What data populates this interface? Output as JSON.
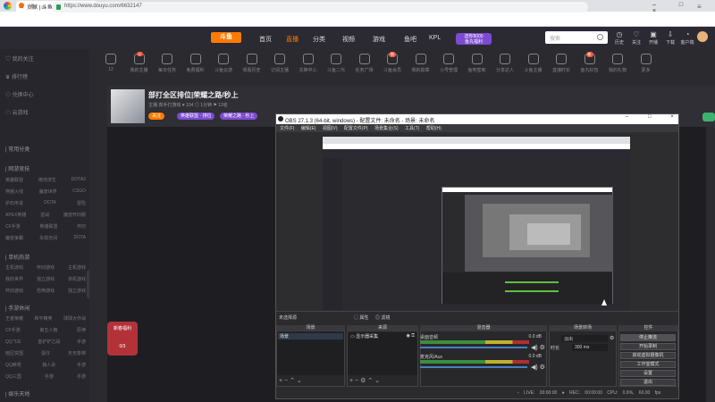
{
  "browser": {
    "tab_title": "贡献 | 斗鱼直播_斗鱼…",
    "url": "https://www.douyu.com/6632147",
    "newtab": "+",
    "win_ctrls": "– □ ×"
  },
  "header": {
    "nav": [
      "首页",
      "直播",
      "分类",
      "视频",
      "游戏",
      "鱼吧",
      "KPL"
    ],
    "logo": "斗鱼",
    "badge_line1": "送你8000",
    "badge_line2": "鱼丸福利",
    "search_placeholder": "搜索",
    "icons": [
      {
        "label": "历史",
        "icon": "history-icon"
      },
      {
        "label": "关注",
        "icon": "heart-icon"
      },
      {
        "label": "开播",
        "icon": "camera-icon"
      },
      {
        "label": "下载",
        "icon": "download-icon"
      },
      {
        "label": "客户端",
        "icon": "app-icon"
      },
      {
        "label": "消息",
        "icon": "bell-icon"
      }
    ]
  },
  "sidebar": {
    "items": [
      "我的关注",
      "排行榜",
      "兑换中心",
      "云游戏"
    ],
    "sections": [
      {
        "title": "| 常用分类",
        "rows": []
      },
      {
        "title": "| 网游竞技",
        "rows": [
          [
            "英雄联盟",
            "绝地求生",
            "DOTA2"
          ],
          [
            "穿越火线",
            "魔兽世界",
            "CSGO"
          ],
          [
            "炉石传说",
            "DOTA",
            "冒险"
          ],
          [
            "APEX英雄",
            "逆战",
            "魔兽怀旧服"
          ],
          [
            "CF手游",
            "英雄联盟",
            "怀旧"
          ],
          [
            "魔兽争霸",
            "永劫无间",
            "DOTA"
          ]
        ]
      },
      {
        "title": "| 单机热游",
        "rows": [
          [
            "主机游戏",
            "怀旧游戏",
            "主机游戏"
          ],
          [
            "我的世界",
            "独立游戏",
            "单机游戏"
          ],
          [
            "怀旧游戏",
            "恐怖游戏",
            "独立游戏"
          ]
        ]
      },
      {
        "title": "| 手游休闲",
        "rows": [
          [
            "王者荣耀",
            "和平精英",
            "球球大作战"
          ],
          [
            "CF手游",
            "第五人格",
            "原神"
          ],
          [
            "QQ飞车",
            "金铲铲之战",
            "手游"
          ],
          [
            "暗区突围",
            "蛋仔",
            "天天象棋"
          ],
          [
            "QQ麻将",
            "狼人杀",
            "手游"
          ],
          [
            "QQ三国",
            "手游",
            "手游"
          ]
        ]
      },
      {
        "title": "| 娱乐天地",
        "rows": []
      }
    ]
  },
  "categories": [
    {
      "label": "12",
      "sub": "元宵订阅",
      "badge": ""
    },
    {
      "label": "我的主播",
      "sub": "",
      "badge": "2"
    },
    {
      "label": "每日任务",
      "sub": "",
      "badge": ""
    },
    {
      "label": "免费福利",
      "sub": "",
      "badge": ""
    },
    {
      "label": "斗鱼云游",
      "sub": "",
      "badge": ""
    },
    {
      "label": "观看历史",
      "sub": "",
      "badge": ""
    },
    {
      "label": "订阅主播",
      "sub": "",
      "badge": ""
    },
    {
      "label": "兑换中心",
      "sub": "",
      "badge": ""
    },
    {
      "label": "斗鱼二代",
      "sub": "",
      "badge": ""
    },
    {
      "label": "任务广场",
      "sub": "",
      "badge": ""
    },
    {
      "label": "斗鱼会员",
      "sub": "",
      "badge": "新"
    },
    {
      "label": "我的勋章",
      "sub": "",
      "badge": ""
    },
    {
      "label": "小号管理",
      "sub": "",
      "badge": ""
    },
    {
      "label": "鱼吧签到",
      "sub": "",
      "badge": ""
    },
    {
      "label": "分享达人",
      "sub": "",
      "badge": ""
    },
    {
      "label": "斗鱼主播",
      "sub": "",
      "badge": ""
    },
    {
      "label": "直播时长",
      "sub": "",
      "badge": ""
    },
    {
      "label": "鱼丸红包",
      "sub": "",
      "badge": "新"
    },
    {
      "label": "我的礼物",
      "sub": "",
      "badge": ""
    },
    {
      "label": "更多",
      "sub": "",
      "badge": ""
    }
  ],
  "stream": {
    "title": "部打全区排位|荣耀之路/秒上",
    "meta": "主播 高手打游戏  ♥ 104  ◎ 1分钟  ⚑ 13名",
    "tag1": "关注",
    "tag2": "英雄联盟 · 排位",
    "tag3": "荣耀之路 · 秒上",
    "gift_label": "新春福利",
    "gift_count": "0/3"
  },
  "obs": {
    "title": "OBS 27.1.3 (64-bit, windows) - 配置文件: 未命名 - 场景: 未命名",
    "menu": [
      "文件(F)",
      "编辑(E)",
      "视图(V)",
      "配置文件(P)",
      "场景集合(S)",
      "工具(T)",
      "帮助(H)"
    ],
    "srcbar_label": "未选择源",
    "props_btn": "◯ 属性",
    "filter_btn": "◎ 滤镜",
    "docks": {
      "scenes": {
        "title": "场景",
        "items": [
          "场景"
        ]
      },
      "sources": {
        "title": "来源",
        "items": [
          "显示器采集"
        ]
      },
      "mixer": {
        "title": "混音器",
        "rows": [
          {
            "name": "桌面音频",
            "db": "0.0 dB"
          },
          {
            "name": "麦克风/Aux",
            "db": "0.0 dB"
          }
        ]
      },
      "transitions": {
        "title": "场景转场",
        "type": "淡出",
        "duration_label": "时长",
        "duration": "300 ms"
      },
      "controls": {
        "title": "控件",
        "buttons": [
          "停止推流",
          "开始录制",
          "启动虚拟摄像机",
          "工作室模式",
          "设置",
          "退出"
        ]
      }
    },
    "status": {
      "live": "LIVE: 00:00:00",
      "rec": "REC: 00:00:00",
      "cpu": "CPU: 0.9%, 60.00 fps"
    }
  }
}
